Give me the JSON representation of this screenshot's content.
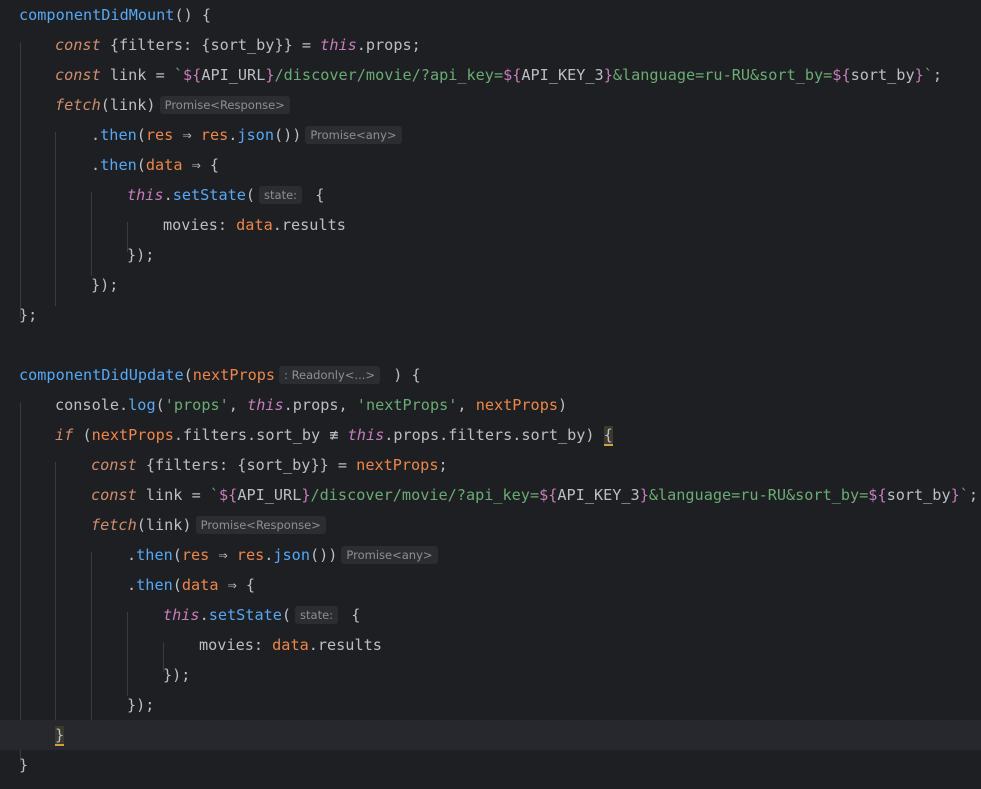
{
  "editor": {
    "lines": [
      {
        "text": "componentDidMount() {"
      },
      {
        "text": "const {filters: {sort_by}} = this.props;"
      },
      {
        "text": "const link = `${API_URL}/discover/movie/?api_key=${API_KEY_3}&language=ru-RU&sort_by=${sort_by}`;"
      },
      {
        "text": "fetch(link)",
        "hint": "Promise<Response>"
      },
      {
        "text": ".then(res => res.json())",
        "hint": "Promise<any>"
      },
      {
        "text": ".then(data => {"
      },
      {
        "text": "this.setState(",
        "hint": "state:",
        "after": "{"
      },
      {
        "text": "movies: data.results"
      },
      {
        "text": "});"
      },
      {
        "text": "});"
      },
      {
        "text": "};"
      },
      {
        "text": ""
      },
      {
        "text": "componentDidUpdate(nextProps",
        "hint": ": Readonly<...>",
        "after": ") {"
      },
      {
        "text": "console.log('props', this.props, 'nextProps', nextProps)"
      },
      {
        "text": "if (nextProps.filters.sort_by !== this.props.filters.sort_by) {"
      },
      {
        "text": "const {filters: {sort_by}} = nextProps;"
      },
      {
        "text": "const link = `${API_URL}/discover/movie/?api_key=${API_KEY_3}&language=ru-RU&sort_by=${sort_by}`;"
      },
      {
        "text": "fetch(link)",
        "hint": "Promise<Response>"
      },
      {
        "text": ".then(res => res.json())",
        "hint": "Promise<any>"
      },
      {
        "text": ".then(data => {"
      },
      {
        "text": "this.setState(",
        "hint": "state:",
        "after": "{"
      },
      {
        "text": "movies: data.results"
      },
      {
        "text": "});"
      },
      {
        "text": "});"
      },
      {
        "text": "}"
      },
      {
        "text": "}"
      }
    ],
    "hints": {
      "promise_response": "Promise<Response>",
      "promise_any": "Promise<any>",
      "state": "state:",
      "readonly": ": Readonly<...>"
    }
  }
}
